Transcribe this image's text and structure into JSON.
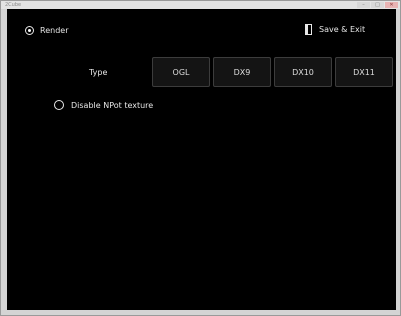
{
  "window": {
    "title": "2Cube",
    "controls": [
      "–",
      "□",
      "✕"
    ]
  },
  "render_option": {
    "label": "Render",
    "selected": true
  },
  "save_exit": {
    "label": "Save & Exit",
    "icon": "door-icon"
  },
  "type_row": {
    "label": "Type",
    "buttons": [
      "OGL",
      "DX9",
      "DX10",
      "DX11"
    ]
  },
  "npot_option": {
    "label": "Disable NPot texture",
    "checked": false
  },
  "colors": {
    "background": "#000000",
    "text": "#e6e6e6",
    "button_bg": "#141414",
    "button_border": "#3c3c3c"
  }
}
